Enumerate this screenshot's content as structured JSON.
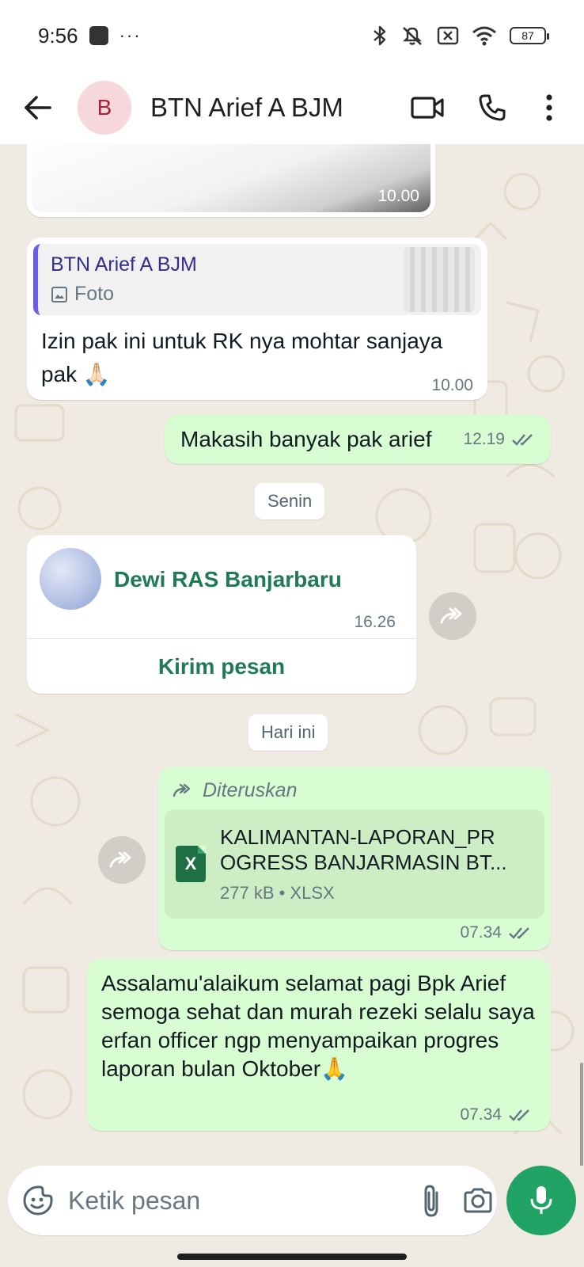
{
  "status_bar": {
    "time": "9:56",
    "overflow": "···",
    "battery": "87",
    "icons": [
      "bluetooth-icon",
      "mute-icon",
      "sim-off-icon",
      "wifi-icon",
      "battery-icon"
    ]
  },
  "header": {
    "avatar_letter": "B",
    "contact_name": "BTN Arief A BJM",
    "icons": [
      "back-arrow-icon",
      "video-call-icon",
      "voice-call-icon",
      "more-vert-icon"
    ]
  },
  "messages": {
    "image_msg": {
      "time": "10.00"
    },
    "reply_msg": {
      "quote_name": "BTN Arief A BJM",
      "quote_type": "Foto",
      "text": "Izin pak ini untuk RK nya mohtar sanjaya pak 🙏🏻",
      "time": "10.00"
    },
    "out_msg_1": {
      "text": "Makasih banyak pak arief",
      "time": "12.19"
    },
    "date_senin": "Senin",
    "contact_card": {
      "name": "Dewi RAS Banjarbaru",
      "time": "16.26",
      "action": "Kirim pesan"
    },
    "date_today": "Hari ini",
    "file_msg": {
      "forwarded_label": "Diteruskan",
      "file_name_line1": "KALIMANTAN-LAPORAN_PR",
      "file_name_line2": "OGRESS BANJARMASIN BT...",
      "file_meta": "277 kB • XLSX",
      "file_icon_letter": "X",
      "time": "07.34"
    },
    "long_msg": {
      "text": "Assalamu'alaikum selamat pagi Bpk Arief semoga sehat dan murah rezeki selalu saya erfan officer ngp menyampaikan progres laporan bulan Oktober🙏",
      "time": "07.34"
    }
  },
  "composer": {
    "placeholder": "Ketik pesan",
    "value": ""
  },
  "colors": {
    "chat_bg": "#efeae2",
    "outgoing_bubble": "#d9fdd3",
    "incoming_bubble": "#ffffff",
    "accent_green": "#21a366",
    "tick_grey": "#667781"
  }
}
